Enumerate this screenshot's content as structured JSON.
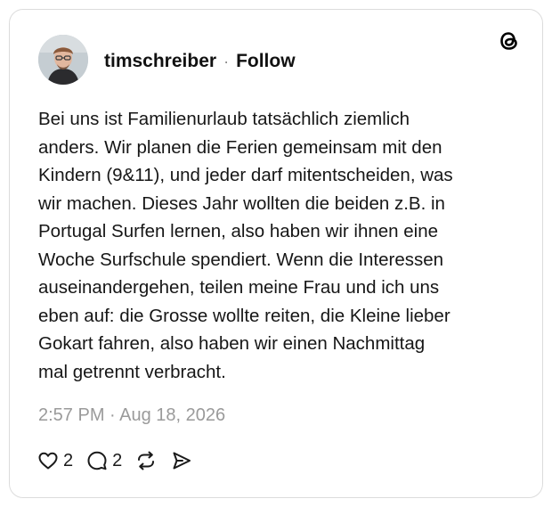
{
  "post": {
    "author": {
      "username": "timschreiber",
      "separator": "·",
      "follow_label": "Follow"
    },
    "text": "Bei uns ist Familienurlaub tatsächlich ziemlich\nanders. Wir planen die Ferien gemeinsam mit den\nKindern (9&11), und jeder darf mitentscheiden, was\nwir machen. Dieses Jahr wollten die beiden z.B. in\nPortugal Surfen lernen, also haben wir ihnen eine\nWoche Surfschule spendiert. Wenn die Interessen\nauseinandergehen, teilen meine Frau und ich uns\neben auf: die Grosse wollte reiten, die Kleine lieber\nGokart fahren, also haben wir einen Nachmittag\nmal getrennt verbracht.",
    "timestamp": "2:57 PM · Aug 18, 2026",
    "actions": {
      "like_count": "2",
      "reply_count": "2"
    }
  },
  "icons": {
    "brand": "threads-logo-icon",
    "like": "heart-icon",
    "reply": "speech-bubble-icon",
    "repost": "repost-icon",
    "share": "send-icon"
  },
  "colors": {
    "text": "#161616",
    "muted": "#9a9a9a",
    "border": "#dcdcdc"
  }
}
